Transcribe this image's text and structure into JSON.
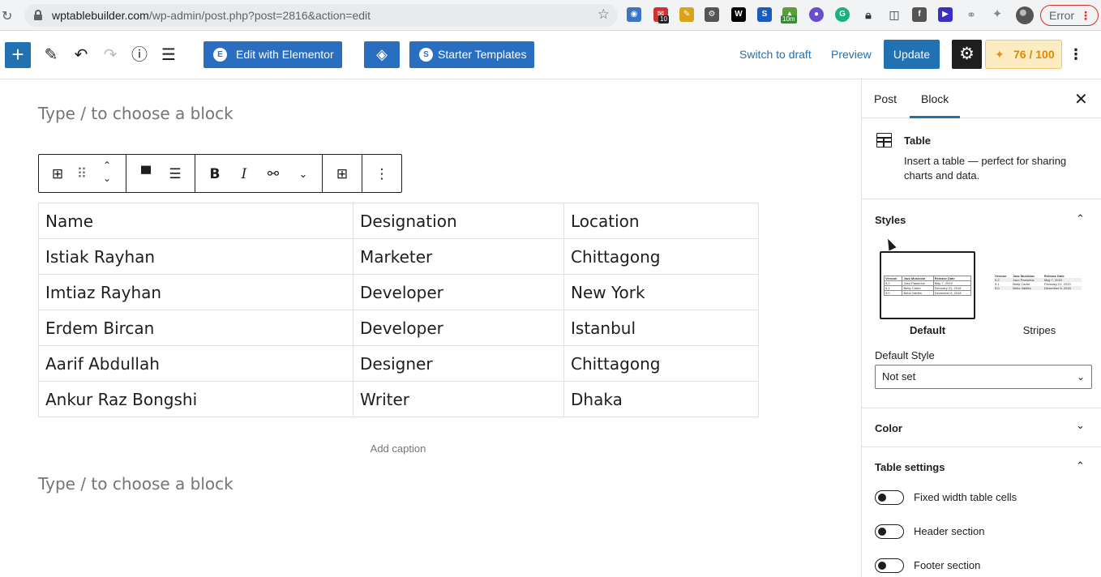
{
  "browser": {
    "url_host": "wptablebuilder.com",
    "url_path": "/wp-admin/post.php?post=2816&action=edit",
    "extension_badges": [
      "10",
      "10m"
    ],
    "error_label": "Error"
  },
  "toolbar": {
    "elementor_label": "Edit with Elementor",
    "starter_label": "Starter Templates",
    "switch_draft_label": "Switch to draft",
    "preview_label": "Preview",
    "update_label": "Update",
    "score_label": "76 / 100"
  },
  "editor": {
    "placeholder_top": "Type / to choose a block",
    "placeholder_bottom": "Type / to choose a block",
    "caption_placeholder": "Add caption",
    "table": {
      "rows": [
        [
          "Name",
          "Designation",
          "Location"
        ],
        [
          "Istiak Rayhan",
          "Marketer",
          "Chittagong"
        ],
        [
          "Imtiaz Rayhan",
          "Developer",
          "New York"
        ],
        [
          "Erdem Bircan",
          "Developer",
          "Istanbul"
        ],
        [
          "Aarif Abdullah",
          "Designer",
          "Chittagong"
        ],
        [
          "Ankur Raz Bongshi",
          "Writer",
          "Dhaka"
        ]
      ]
    }
  },
  "sidebar": {
    "tabs": [
      "Post",
      "Block"
    ],
    "active_tab": "Block",
    "block": {
      "title": "Table",
      "description": "Insert a table — perfect for sharing charts and data."
    },
    "styles": {
      "heading": "Styles",
      "options": [
        "Default",
        "Stripes"
      ],
      "selected": "Default",
      "preview_table": [
        [
          "Version",
          "Jazz Musician",
          "Release Date"
        ],
        [
          "5.2",
          "Jaco Pastorius",
          "May 7, 2019"
        ],
        [
          "5.1",
          "Betty Carter",
          "February 21, 2019"
        ],
        [
          "5.0",
          "Bebo Valdés",
          "December 6, 2018"
        ]
      ],
      "default_style_label": "Default Style",
      "default_style_value": "Not set"
    },
    "color_heading": "Color",
    "table_settings": {
      "heading": "Table settings",
      "toggles": [
        "Fixed width table cells",
        "Header section",
        "Footer section"
      ]
    }
  },
  "colors": {
    "wp_blue": "#2271b1",
    "elementor_blue": "#2a6ebf",
    "score_orange": "#d98a00",
    "error_red": "#d93025"
  }
}
